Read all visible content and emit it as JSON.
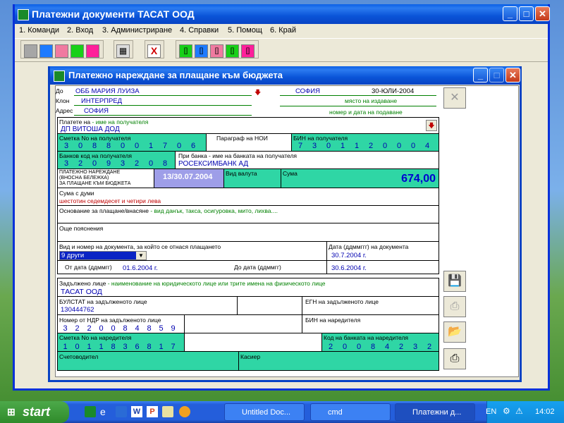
{
  "outer_window": {
    "title": "Платежни документи  ТАСАТ ООД",
    "menu": [
      "1. Команди",
      "2. Вход",
      "3. Администриране",
      "4. Справки",
      "5. Помощ",
      "6. Край"
    ],
    "toolbar_colors": [
      "#a6a6a6",
      "#1e7bff",
      "#f07aa0",
      "#18d018",
      "#ff1f9a"
    ],
    "toolbar_doc_colors": [
      "#18d018",
      "#1e7bff",
      "#f07aa0",
      "#18d018",
      "#ff1f9a"
    ]
  },
  "dialog": {
    "title": "Платежно нареждане за плащане към бюджета",
    "to_label": "До",
    "to_value": "ОББ МАРИЯ ЛУИЗА",
    "branch_label": "Клон",
    "branch_value": "ИНТЕРПРЕД",
    "address_label": "Адрес",
    "address_value": "СОФИЯ",
    "place_value": "СОФИЯ",
    "date_value": "30-ЮЛИ-2004",
    "place_hint": "място на издаване",
    "number_date_hint": "номер и дата на подаване",
    "payer_label": "Платете на",
    "payer_hint": "- име на получателя",
    "payer_value": "ДП ВИТОША ДОД",
    "account_label": "Сметка No на получателя",
    "account_digits": [
      "3",
      "0",
      "8",
      "8",
      "0",
      "0",
      "1",
      "7",
      "0",
      "6"
    ],
    "nra_para_label": "Параграф на НОИ",
    "bin_recv_label": "БИН на получателя",
    "bin_recv_digits": [
      "7",
      "3",
      "0",
      "1",
      "1",
      "2",
      "0",
      "0",
      "0",
      "4"
    ],
    "bank_code_label": "Банков код на получателя",
    "bank_code_digits": [
      "3",
      "2",
      "0",
      "9",
      "3",
      "2",
      "0",
      "8"
    ],
    "bank_name_label": "При банка - име на банката на получателя",
    "bank_name_value": "РОСЕКСИМБАНК АД",
    "doc_type_lines": [
      "ПЛАТЕЖНО НАРЕЖДАНЕ",
      "(ВНОСНА БЕЛЕЖКА)",
      "ЗА ПЛАЩАНЕ КЪМ БЮДЖЕТА"
    ],
    "doc_date": "13/30.07.2004",
    "currency_label": "Вид валута",
    "amount_label": "Сума",
    "amount_value": "674,00",
    "amount_words_label": "Сума с думи",
    "amount_words_value": "шестотин седемдесет и четири лева",
    "basis_label": "Основание за плащане/внасяне",
    "basis_hint": "- вид данък, такса, осигуровка, мито, лихва....",
    "extra_label": "Още пояснения",
    "doc_kind_label": "Вид и номер на документа, за който се отнася плащането",
    "doc_kind_value": "9  други",
    "doc_date_label": "Дата (ддммггг) на документа",
    "doc_date_value": "30.7.2004 г.",
    "from_label": "От дата (ддммгг)",
    "from_value": "01.6.2004 г.",
    "to_date_label": "До дата (ддммгг)",
    "to_date_value": "30.6.2004 г.",
    "obliged_label": "Задължено лице",
    "obliged_hint": "- наименование на юридическото лице или трите имена на физическото лице",
    "obliged_value": "ТАСАТ ООД",
    "bulstat_label": "БУЛСТАТ на задълженото лице",
    "bulstat_value": "130444762",
    "egn_label": "ЕГН на задълженото лице",
    "ndr_label": "Номер от НДР на задълженото лице",
    "ndr_digits": [
      "3",
      "2",
      "2",
      "0",
      "0",
      "8",
      "4",
      "8",
      "5",
      "9"
    ],
    "bin_payer_label": "БИН на наредителя",
    "payer_account_label": "Сметка No на наредителя",
    "payer_account_digits": [
      "1",
      "0",
      "1",
      "1",
      "8",
      "3",
      "6",
      "8",
      "1",
      "7"
    ],
    "payer_bank_label": "Код на банката на наредителя",
    "payer_bank_digits": [
      "2",
      "0",
      "0",
      "8",
      "4",
      "2",
      "3",
      "2"
    ],
    "accountant_label": "Счетоводител",
    "cashier_label": "Касиер"
  },
  "taskbar": {
    "start_label": "start",
    "tasks": [
      "Untitled Doc...",
      "cmd",
      "Платежни д..."
    ],
    "lang": "EN",
    "clock": "14:02"
  }
}
